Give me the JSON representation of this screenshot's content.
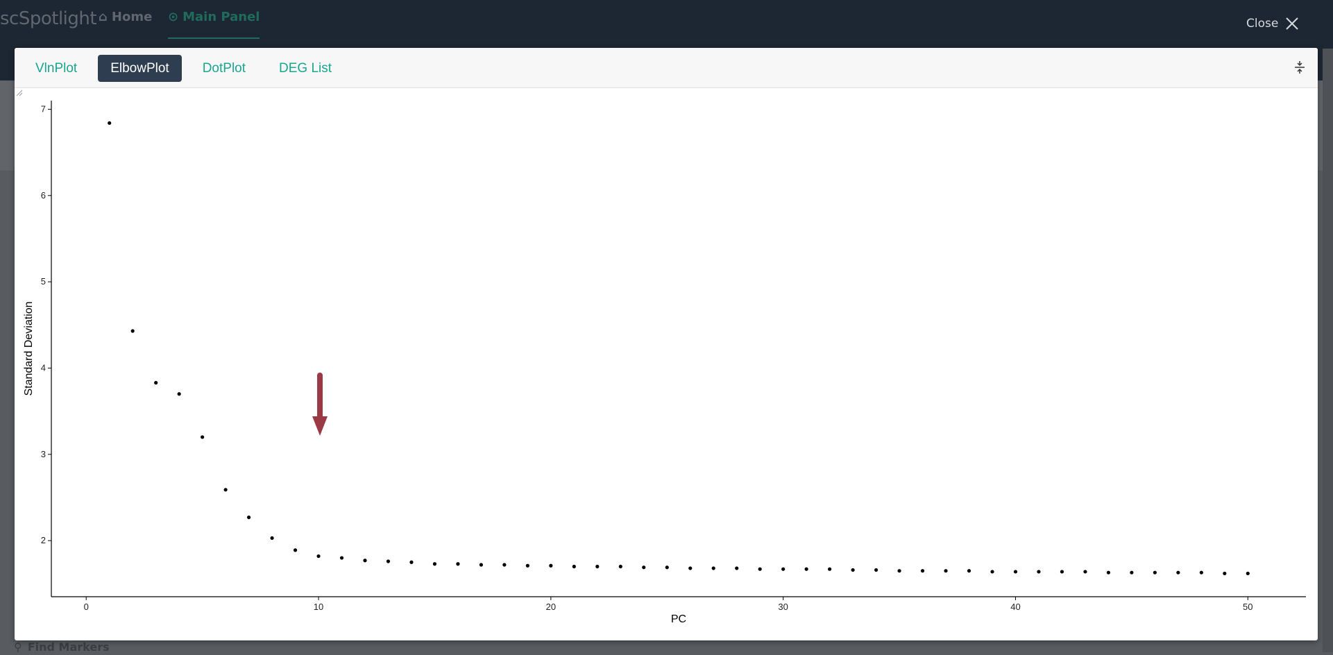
{
  "app": {
    "brand": "scSpotlight",
    "nav_home": "Home",
    "nav_main": "Main Panel",
    "bottom_label": "Find Markers"
  },
  "close_label": "Close",
  "tabs": [
    "VlnPlot",
    "ElbowPlot",
    "DotPlot",
    "DEG List"
  ],
  "active_tab": "ElbowPlot",
  "colors": {
    "accent": "#1aa58d",
    "active_tab_bg": "#2e3d4f",
    "arrow": "#9b3a44"
  },
  "chart_data": {
    "type": "scatter",
    "title": "",
    "xlabel": "PC",
    "ylabel": "Standard Deviation",
    "xlim": [
      -1.5,
      52.5
    ],
    "ylim": [
      1.35,
      7.1
    ],
    "xticks": [
      0,
      10,
      20,
      30,
      40,
      50
    ],
    "yticks": [
      2,
      3,
      4,
      5,
      6,
      7
    ],
    "grid": false,
    "x": [
      1,
      2,
      3,
      4,
      5,
      6,
      7,
      8,
      9,
      10,
      11,
      12,
      13,
      14,
      15,
      16,
      17,
      18,
      19,
      20,
      21,
      22,
      23,
      24,
      25,
      26,
      27,
      28,
      29,
      30,
      31,
      32,
      33,
      34,
      35,
      36,
      37,
      38,
      39,
      40,
      41,
      42,
      43,
      44,
      45,
      46,
      47,
      48,
      49,
      50
    ],
    "values": [
      6.84,
      4.43,
      3.83,
      3.7,
      3.2,
      2.59,
      2.27,
      2.03,
      1.89,
      1.82,
      1.8,
      1.77,
      1.76,
      1.75,
      1.73,
      1.73,
      1.72,
      1.72,
      1.71,
      1.71,
      1.7,
      1.7,
      1.7,
      1.69,
      1.69,
      1.68,
      1.68,
      1.68,
      1.67,
      1.67,
      1.67,
      1.67,
      1.66,
      1.66,
      1.65,
      1.65,
      1.65,
      1.65,
      1.64,
      1.64,
      1.64,
      1.64,
      1.64,
      1.63,
      1.63,
      1.63,
      1.63,
      1.63,
      1.62,
      1.62
    ],
    "annotation": {
      "type": "arrow",
      "points_to_x": 10
    }
  }
}
